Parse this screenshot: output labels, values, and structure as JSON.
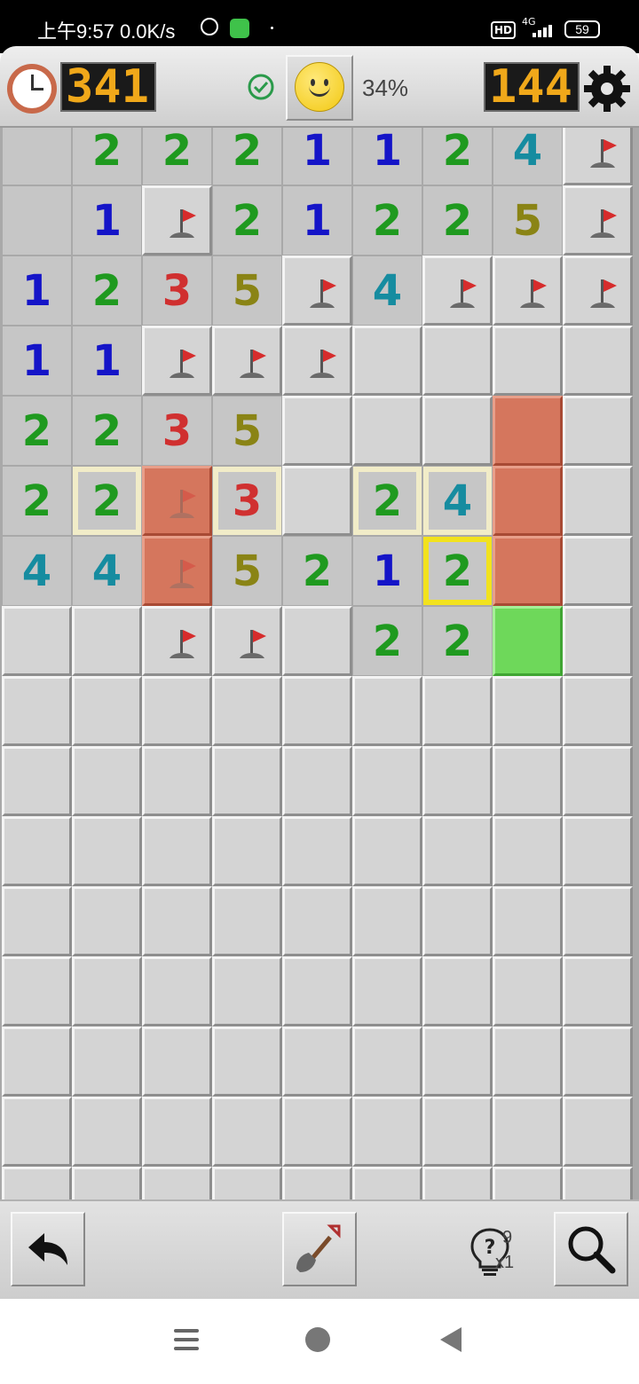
{
  "status_bar": {
    "time": "上午9:57",
    "net_speed": "0.0K/s",
    "network": "4G",
    "hd_badge": "HD",
    "battery": "59"
  },
  "header": {
    "timer": "341",
    "mines_left": "144",
    "progress": "34%",
    "colors": {
      "lcd_digits": "#f0a81a",
      "lcd_bg": "#1a1a1a"
    }
  },
  "board": {
    "columns": 9,
    "visible_rows": 16,
    "legend": "N=hidden, F=flag, digit=revealed number, R=red highlight, RF=red highlight with flag, G=green highlight, c=cream outline, y=yellow outline",
    "rows": [
      [
        "O",
        "2",
        "2",
        "2",
        "1",
        "1",
        "2",
        "4",
        "F"
      ],
      [
        "O",
        "1",
        "F",
        "2",
        "1",
        "2",
        "2",
        "5",
        "F"
      ],
      [
        "1",
        "2",
        "3",
        "5",
        "F",
        "4",
        "F",
        "F",
        "F"
      ],
      [
        "1",
        "1",
        "F",
        "F",
        "F",
        "N",
        "N",
        "N",
        "N"
      ],
      [
        "2",
        "2",
        "3",
        "5",
        "N",
        "N",
        "N",
        "R",
        "N"
      ],
      [
        "2",
        "2c",
        "RF",
        "3c",
        "N",
        "2c",
        "4c",
        "R",
        "N"
      ],
      [
        "4",
        "4",
        "RF",
        "5",
        "2",
        "1",
        "2y",
        "R",
        "N"
      ],
      [
        "N",
        "N",
        "F",
        "F",
        "N",
        "2",
        "2",
        "G",
        "N"
      ],
      [
        "N",
        "N",
        "N",
        "N",
        "N",
        "N",
        "N",
        "N",
        "N"
      ],
      [
        "N",
        "N",
        "N",
        "N",
        "N",
        "N",
        "N",
        "N",
        "N"
      ],
      [
        "N",
        "N",
        "N",
        "N",
        "N",
        "N",
        "N",
        "N",
        "N"
      ],
      [
        "N",
        "N",
        "N",
        "N",
        "N",
        "N",
        "N",
        "N",
        "N"
      ],
      [
        "N",
        "N",
        "N",
        "N",
        "N",
        "N",
        "N",
        "N",
        "N"
      ],
      [
        "N",
        "N",
        "N",
        "N",
        "N",
        "N",
        "N",
        "N",
        "N"
      ],
      [
        "N",
        "N",
        "N",
        "N",
        "N",
        "N",
        "N",
        "N",
        "N"
      ],
      [
        "N",
        "N",
        "N",
        "N",
        "N",
        "N",
        "N",
        "N",
        "N"
      ]
    ],
    "number_colors": {
      "1": "#1414c8",
      "2": "#1f9a1f",
      "3": "#d03030",
      "4": "#168ca0",
      "5": "#8a8415"
    }
  },
  "toolbar": {
    "hint_count": "9",
    "hint_multiplier": "x1",
    "icons": [
      "undo-icon",
      "shovel-icon",
      "hint-bulb-icon",
      "magnifier-icon"
    ]
  },
  "navbar": {
    "icons": [
      "menu-icon",
      "home-icon",
      "back-icon"
    ]
  }
}
